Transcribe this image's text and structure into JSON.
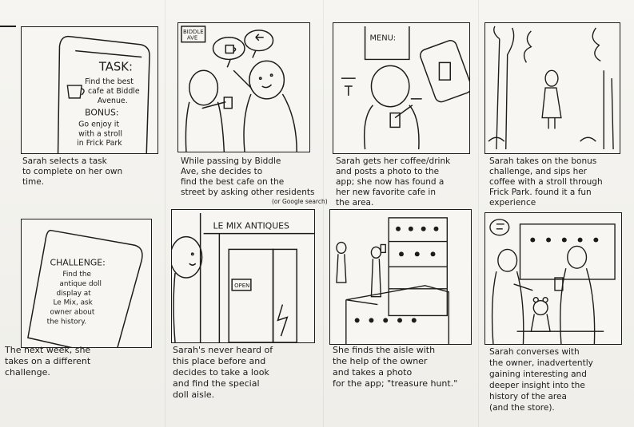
{
  "captions": [
    "Sarah selects a task\nto complete on her own\ntime.",
    "While passing by Biddle\nAve, she decides to\nfind the best cafe on the\nstreet by asking other residents",
    "Sarah gets her coffee/drink\nand posts a photo to the\napp; she now has found a\nher new favorite cafe in\nthe area.",
    "Sarah takes on the bonus\nchallenge, and sips her\ncoffee with a stroll through\nFrick Park. found it a fun\nexperience",
    "The next week, she\ntakes on a different\nchallenge.",
    "Sarah's never heard of\nthis place before and\ndecides to take a look\nand find the special\ndoll aisle.",
    "She finds the aisle with\nthe help of the owner\nand takes a photo\nfor the app; \"treasure hunt.\"",
    "Sarah converses with\nthe owner, inadvertently\ngaining interesting and\ndeeper insight into the\nhistory of the area\n(and the store)."
  ],
  "annotation_or_google": "(or Google search)",
  "panel_text": {
    "task_title": "TASK:",
    "task_body": [
      "Find the best",
      "cafe at Biddle",
      "Avenue."
    ],
    "bonus_title": "BONUS:",
    "bonus_body": [
      "Go enjoy it",
      "with a stroll",
      "in Frick Park"
    ],
    "street_sign": [
      "BIDDLE",
      "AVE"
    ],
    "menu_sign": "MENU:",
    "challenge_title": "CHALLENGE:",
    "challenge_body": [
      "Find the",
      "antique doll",
      "display at",
      "Le Mix, ask",
      "owner about",
      "the history."
    ],
    "store_sign": "LE MIX ANTIQUES",
    "open_sign": "OPEN"
  }
}
